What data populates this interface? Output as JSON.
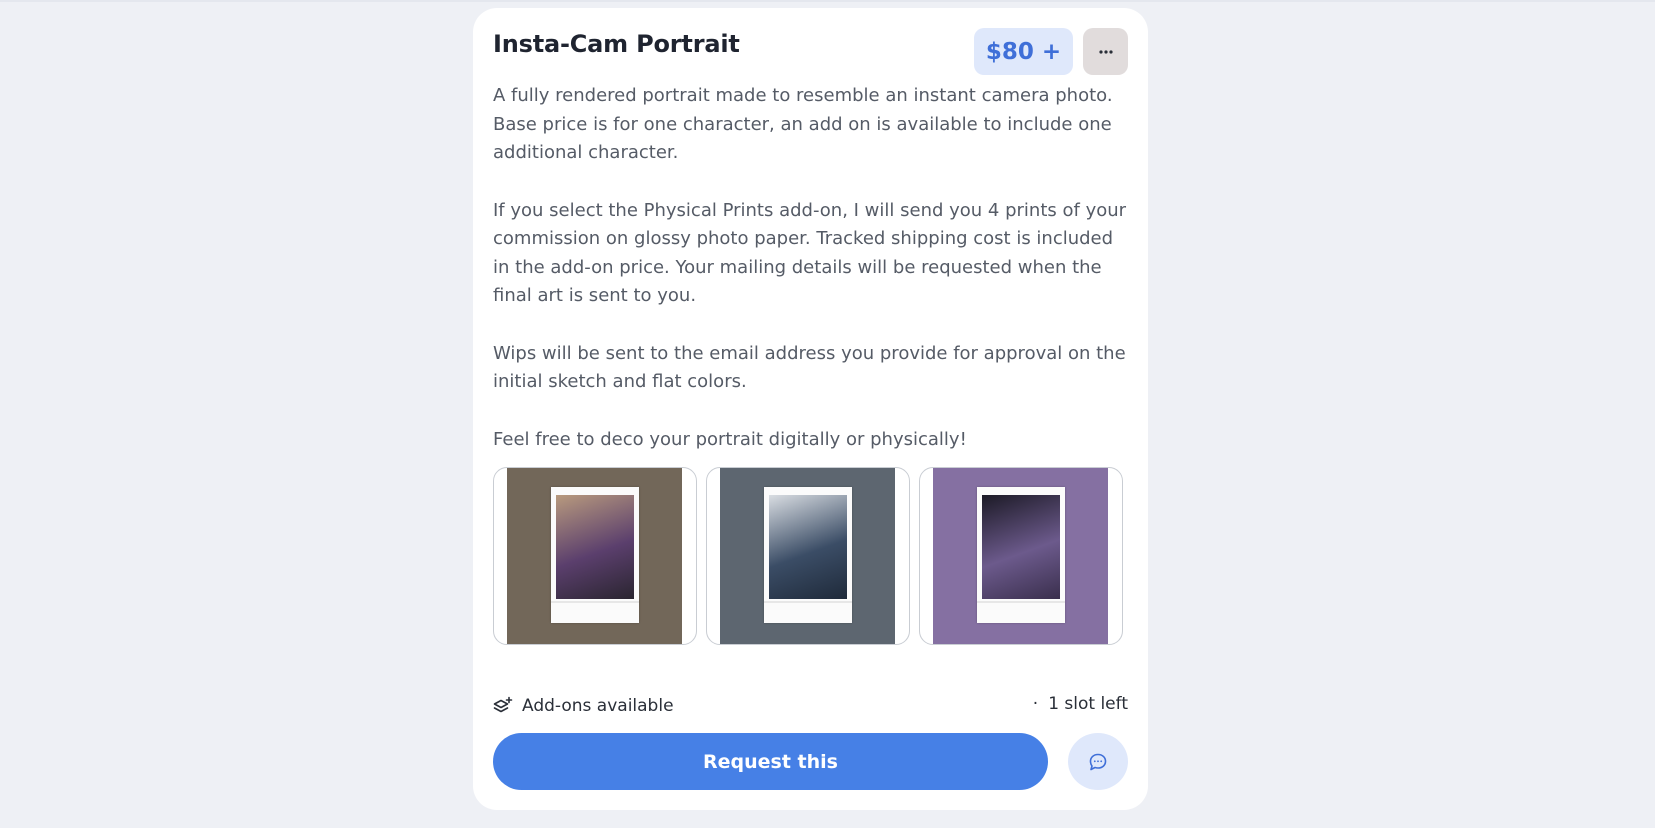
{
  "commission": {
    "title": "Insta-Cam Portrait",
    "price": "$80 +",
    "more_label": "···",
    "description": [
      "A fully rendered portrait made to resemble an instant camera photo. Base price is for one character, an add on is available to include one additional character.",
      "If you select the Physical Prints add-on, I will send you 4 prints of your commission on glossy photo paper. Tracked shipping cost is included in the add-on price. Your mailing details will be requested when the final art is sent to you.",
      "Wips will be sent to the email address you provide for approval on the initial sketch and flat colors.",
      "Feel free to deco your portrait digitally or physically!"
    ],
    "gallery": [
      {
        "background": "#726759",
        "photo_colors": [
          "#b89a7e",
          "#5b3f6d",
          "#2a2530"
        ]
      },
      {
        "background": "#5d6670",
        "photo_colors": [
          "#d9dde2",
          "#3b4d66",
          "#1f2a3a"
        ]
      },
      {
        "background": "#8570a2",
        "photo_colors": [
          "#1c1a26",
          "#6c5a8c",
          "#3a2f4d"
        ]
      }
    ],
    "addons_label": "Add-ons available",
    "slots_dot": "·",
    "slots_label": "1 slot left",
    "request_label": "Request this"
  },
  "icons": {
    "more": "ellipsis-icon",
    "addons": "layers-plus-icon",
    "chat": "chat-bubble-icon"
  },
  "colors": {
    "accent": "#4680e6",
    "price_bg": "#dfe8fb",
    "price_text": "#3f6fd8",
    "page_bg": "#eef0f5"
  }
}
